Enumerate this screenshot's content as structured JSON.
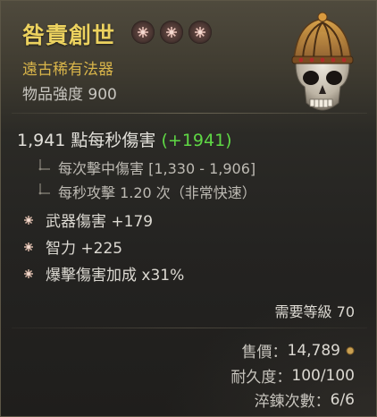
{
  "item": {
    "name": "咎責創世",
    "type": "遠古稀有法器",
    "power": "物品強度 900",
    "socket_count": 3
  },
  "dps": {
    "main": "1,941 點每秒傷害",
    "delta": "(+1941)",
    "damage_per_hit": "每次擊中傷害 [1,330 - 1,906]",
    "attacks_per_second": "每秒攻擊 1.20 次（非常快速）"
  },
  "affixes": [
    {
      "text": "武器傷害 +179"
    },
    {
      "text": "智力 +225"
    },
    {
      "text": "爆擊傷害加成 x31%"
    }
  ],
  "requirement": "需要等級 70",
  "footer": {
    "sell_label": "售價：",
    "sell_value": "14,789",
    "durability_label": "耐久度：",
    "durability_value": "100/100",
    "temper_label": "淬鍊次數：",
    "temper_value": "6/6"
  },
  "icons": {
    "item": "skull-crown-icon",
    "socket": "socket-icon",
    "affix_bullet": "affix-bullet-icon",
    "branch": "tree-branch-icon",
    "gold": "gold-coin-icon"
  },
  "colors": {
    "name": "#ecd25f",
    "type": "#d9b54a",
    "delta": "#5fd845",
    "text": "#dcd9d2"
  }
}
